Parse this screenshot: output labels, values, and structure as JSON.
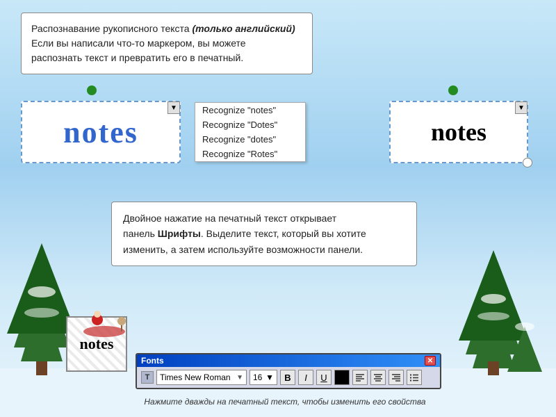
{
  "info_top": {
    "line1": "Распознавание рукописного текста ",
    "line1_italic": "(только английский)",
    "line2": "Если вы написали что-то маркером, вы можете",
    "line3": "распознать текст и превратить его в печатный."
  },
  "handwritten": {
    "text": "notes"
  },
  "dropdown": {
    "items": [
      "Recognize \"notes\"",
      "Recognize \"Dotes\"",
      "Recognize \"dotes\"",
      "Recognize \"Rotes\""
    ]
  },
  "recognized": {
    "text": "notes"
  },
  "info_mid": {
    "line1": "Двойное нажатие на печатный текст открывает",
    "line2_start": "панель ",
    "line2_bold": "Шрифты",
    "line2_end": ". Выделите текст, который вы хотите",
    "line3": "изменить, а затем используйте возможности панели."
  },
  "fonts_panel": {
    "title": "Fonts",
    "close_label": "✕",
    "font_icon": "T",
    "font_name": "Times New Roman",
    "font_size": "16",
    "btn_bold": "B",
    "btn_italic": "I",
    "btn_underline": "U",
    "align_left": "≡",
    "align_center": "≡",
    "align_right": "≡",
    "list_btn": "≡"
  },
  "notes_box": {
    "text": "notes"
  },
  "caption": {
    "text": "Нажмите дважды на печатный текст, чтобы изменить его свойства"
  }
}
